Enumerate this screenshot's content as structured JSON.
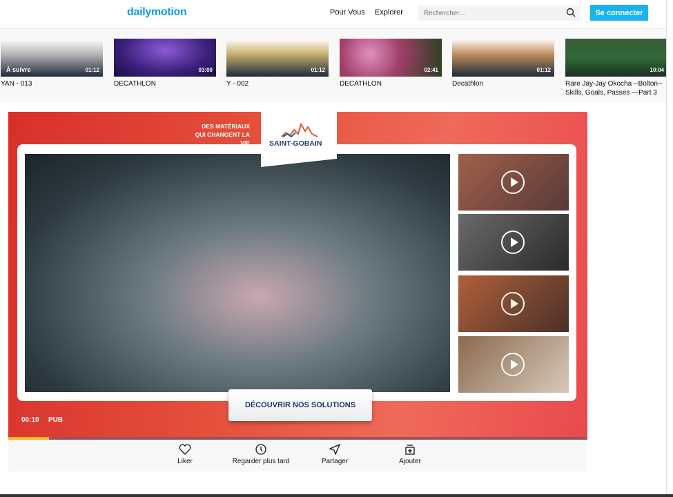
{
  "header": {
    "logo": "dailymotion",
    "nav": [
      "Pour Vous",
      "Explorer"
    ],
    "search_placeholder": "Rechercher...",
    "login": "Se connecter"
  },
  "strip": [
    {
      "title": "YAN - 013",
      "duration": "01:12",
      "badge": "À suivre"
    },
    {
      "title": "DECATHLON",
      "duration": "03:00"
    },
    {
      "title": "Y - 002",
      "duration": "01:12"
    },
    {
      "title": "DECATHLON",
      "duration": "02:41"
    },
    {
      "title": "Decathlon",
      "duration": "01:12"
    },
    {
      "title": "Rare Jay-Jay Okocha --Bolton-- Skills, Goals, Passes ---Part 3",
      "duration": "10:04"
    }
  ],
  "ad": {
    "tagline1": "DES MATÉRIAUX",
    "tagline2": "QUI CHANGENT LA VIE",
    "brand": "SAINT-GOBAIN",
    "cta": "DÉCOUVRIR NOS SOLUTIONS",
    "time": "00:10",
    "label": "PUB",
    "progress_percent": 7
  },
  "actions": [
    "Liker",
    "Regarder plus tard",
    "Partager",
    "Ajouter"
  ]
}
